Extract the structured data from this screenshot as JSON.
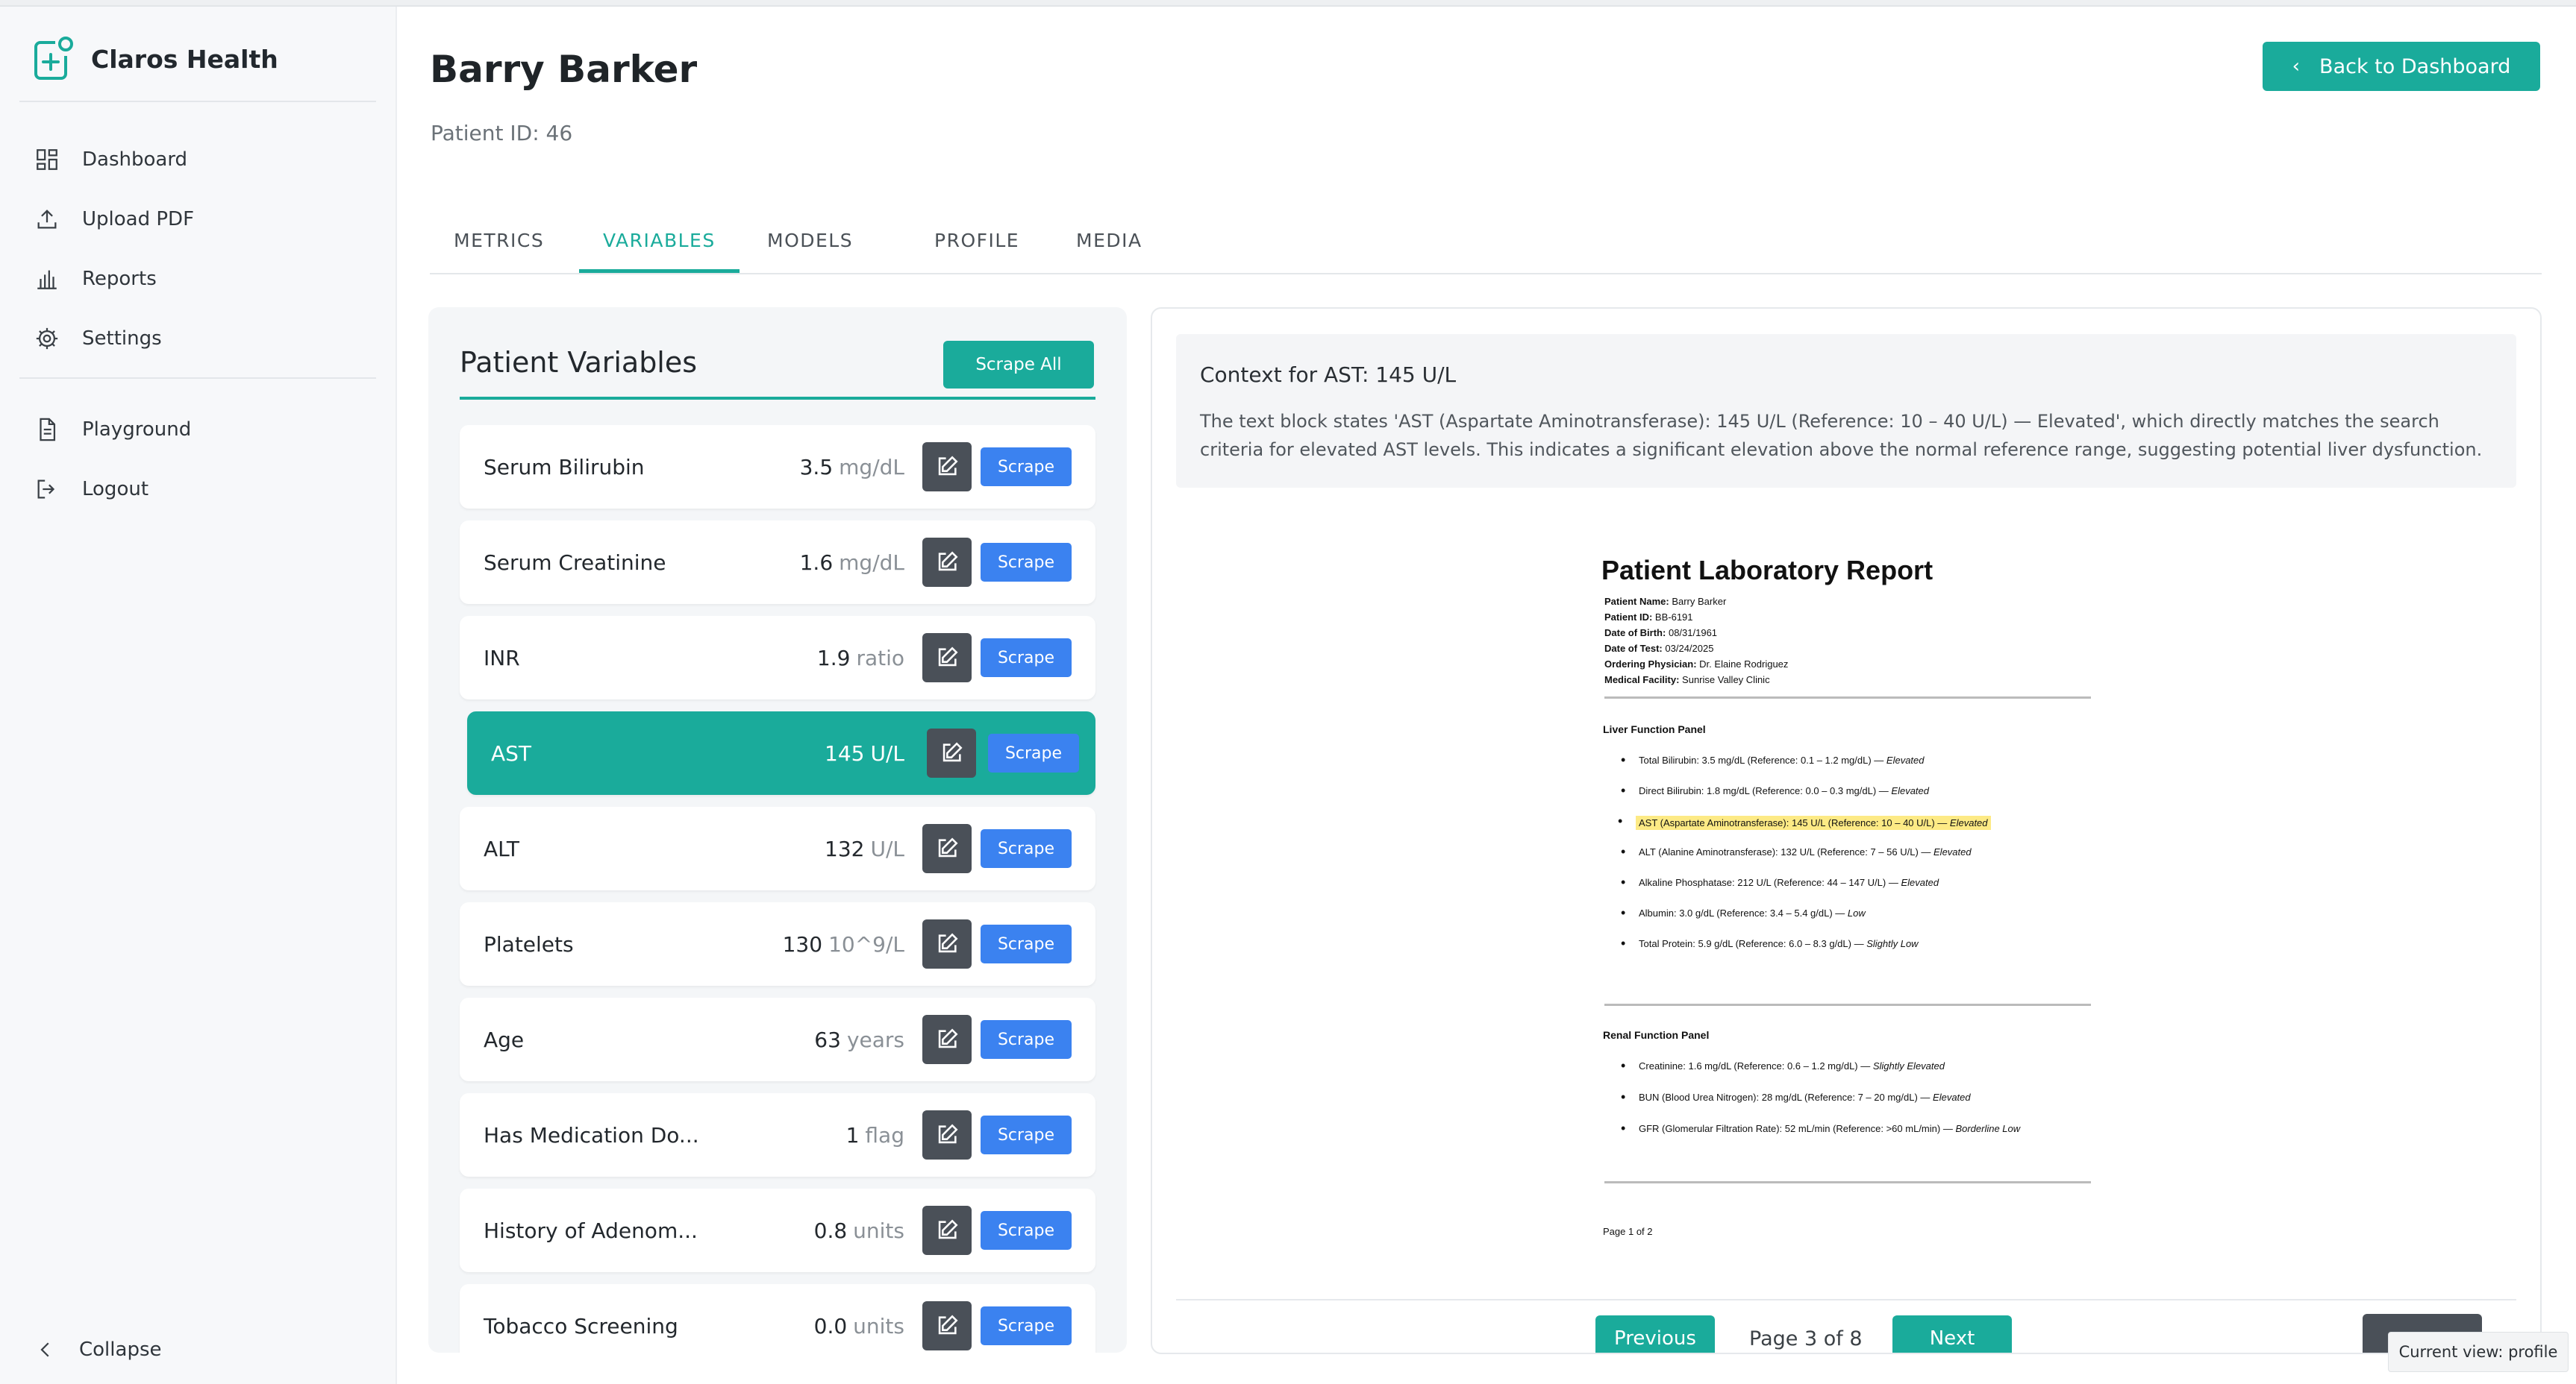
{
  "brand": {
    "name": "Claros Health",
    "color": "#1aab9b"
  },
  "sidebar": {
    "items": [
      {
        "label": "Dashboard",
        "icon": "grid-icon"
      },
      {
        "label": "Upload PDF",
        "icon": "upload-icon"
      },
      {
        "label": "Reports",
        "icon": "bar-chart-icon"
      },
      {
        "label": "Settings",
        "icon": "gear-icon"
      },
      {
        "label": "Playground",
        "icon": "document-icon"
      },
      {
        "label": "Logout",
        "icon": "logout-icon"
      }
    ],
    "collapse_label": "Collapse"
  },
  "header": {
    "patient_name": "Barry Barker",
    "patient_id": "Patient ID: 46",
    "back_label": "Back to Dashboard"
  },
  "tabs": [
    {
      "label": "METRICS",
      "active": false
    },
    {
      "label": "VARIABLES",
      "active": true
    },
    {
      "label": "MODELS",
      "active": false
    },
    {
      "label": "PROFILE",
      "active": false
    },
    {
      "label": "MEDIA",
      "active": false
    }
  ],
  "variables": {
    "title": "Patient Variables",
    "scrape_all_label": "Scrape All",
    "scrape_label": "Scrape",
    "rows": [
      {
        "name": "Serum Bilirubin",
        "value": "3.5",
        "unit": "mg/dL",
        "active": false
      },
      {
        "name": "Serum Creatinine",
        "value": "1.6",
        "unit": "mg/dL",
        "active": false
      },
      {
        "name": "INR",
        "value": "1.9",
        "unit": "ratio",
        "active": false
      },
      {
        "name": "AST",
        "value": "145",
        "unit": "U/L",
        "active": true
      },
      {
        "name": "ALT",
        "value": "132",
        "unit": "U/L",
        "active": false
      },
      {
        "name": "Platelets",
        "value": "130",
        "unit": "10^9/L",
        "active": false
      },
      {
        "name": "Age",
        "value": "63",
        "unit": "years",
        "active": false
      },
      {
        "name": "Has Medication Do...",
        "value": "1",
        "unit": "flag",
        "active": false
      },
      {
        "name": "History of Adenom...",
        "value": "0.8",
        "unit": "units",
        "active": false
      },
      {
        "name": "Tobacco Screening",
        "value": "0.0",
        "unit": "units",
        "active": false
      }
    ]
  },
  "context": {
    "title": "Context for AST: 145 U/L",
    "text": "The text block states 'AST (Aspartate Aminotransferase): 145 U/L (Reference: 10 – 40 U/L) — Elevated', which directly matches the search criteria for elevated AST levels. This indicates a significant elevation above the normal reference range, suggesting potential liver dysfunction."
  },
  "report": {
    "title": "Patient Laboratory Report",
    "meta": [
      {
        "k": "Patient Name:",
        "v": "Barry Barker"
      },
      {
        "k": "Patient ID:",
        "v": "BB-6191"
      },
      {
        "k": "Date of Birth:",
        "v": "08/31/1961"
      },
      {
        "k": "Date of Test:",
        "v": "03/24/2025"
      },
      {
        "k": "Ordering Physician:",
        "v": "Dr. Elaine Rodriguez"
      },
      {
        "k": "Medical Facility:",
        "v": "Sunrise Valley Clinic"
      }
    ],
    "liver_title": "Liver Function Panel",
    "liver_items": [
      {
        "text": "Total Bilirubin: 3.5 mg/dL (Reference: 0.1 – 1.2 mg/dL) — ",
        "flag": "Elevated"
      },
      {
        "text": "Direct Bilirubin: 1.8 mg/dL (Reference: 0.0 – 0.3 mg/dL) — ",
        "flag": "Elevated"
      },
      {
        "text": "AST (Aspartate Aminotransferase): 145 U/L (Reference: 10 – 40 U/L) — ",
        "flag": "Elevated"
      },
      {
        "text": "ALT (Alanine Aminotransferase): 132 U/L (Reference: 7 – 56 U/L) — ",
        "flag": "Elevated"
      },
      {
        "text": "Alkaline Phosphatase: 212 U/L (Reference: 44 – 147 U/L) — ",
        "flag": "Elevated"
      },
      {
        "text": "Albumin: 3.0 g/dL (Reference: 3.4 – 5.4 g/dL) — ",
        "flag": "Low"
      },
      {
        "text": "Total Protein: 5.9 g/dL (Reference: 6.0 – 8.3 g/dL) — ",
        "flag": "Slightly Low"
      }
    ],
    "renal_title": "Renal Function Panel",
    "renal_items": [
      {
        "text": "Creatinine: 1.6 mg/dL (Reference: 0.6 – 1.2 mg/dL) — ",
        "flag": "Slightly Elevated"
      },
      {
        "text": "BUN (Blood Urea Nitrogen): 28 mg/dL (Reference: 7 – 20 mg/dL) — ",
        "flag": "Elevated"
      },
      {
        "text": "GFR (Glomerular Filtration Rate): 52 mL/min (Reference: >60 mL/min) — ",
        "flag": "Borderline Low"
      }
    ],
    "footer": "Page 1 of 2"
  },
  "pager": {
    "previous_label": "Previous",
    "page_info": "Page 3 of 8",
    "next_label": "Next"
  },
  "current_view": "Current view: profile"
}
